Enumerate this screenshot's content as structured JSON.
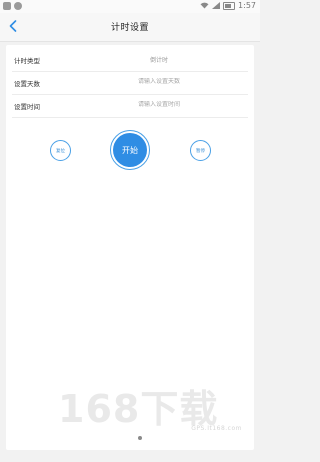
{
  "status_bar": {
    "time": "1:57"
  },
  "header": {
    "title": "计时设置",
    "back_icon": "chevron-left-icon",
    "accent_color": "#2f8de4"
  },
  "form": {
    "rows": [
      {
        "label": "计时类型",
        "value": "倒计时",
        "placeholder": ""
      },
      {
        "label": "设置天数",
        "value": "",
        "placeholder": "请输入设置天数"
      },
      {
        "label": "设置时间",
        "value": "",
        "placeholder": "请输入设置时间"
      }
    ]
  },
  "controls": {
    "reset_label": "复位",
    "start_label": "开始",
    "pause_label": "暂停"
  },
  "watermark": {
    "main": "168下载",
    "sub": "GPS.It168.com"
  }
}
